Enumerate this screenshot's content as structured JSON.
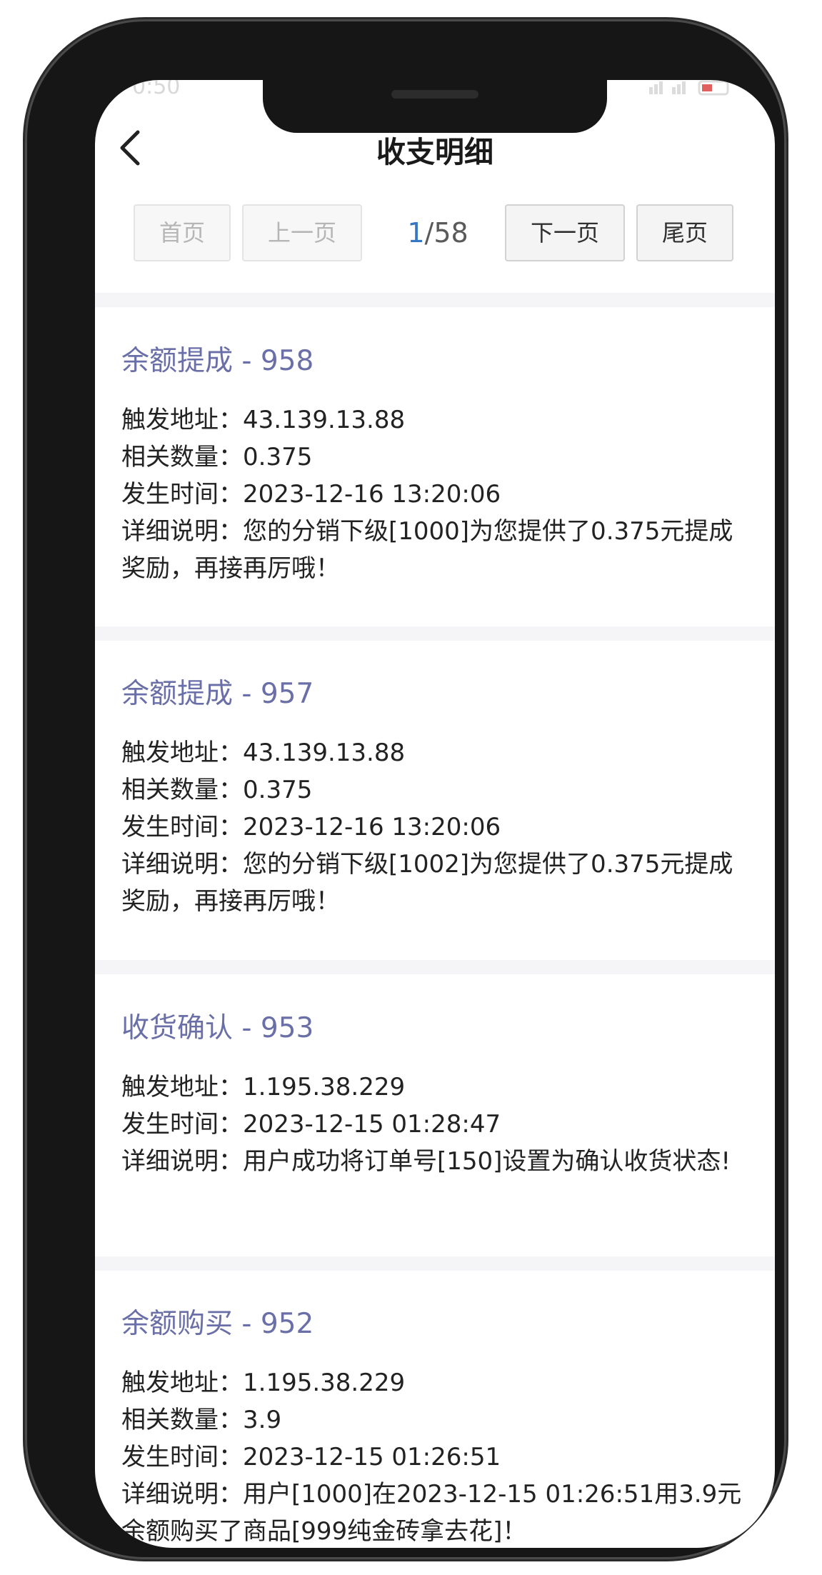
{
  "status_bar": {
    "time": "0:50",
    "icons": "signal-icon wifi-icon battery-icon"
  },
  "header": {
    "title": "收支明细"
  },
  "pager": {
    "first": "首页",
    "prev": "上一页",
    "current": "1",
    "separator": "/",
    "total": "58",
    "next": "下一页",
    "last": "尾页"
  },
  "labels": {
    "address": "触发地址：",
    "amount": "相关数量：",
    "time": "发生时间：",
    "detail": "详细说明："
  },
  "records": [
    {
      "title": "余额提成 - 958",
      "address": "43.139.13.88",
      "amount": "0.375",
      "time": "2023-12-16 13:20:06",
      "detail": "您的分销下级[1000]为您提供了0.375元提成奖励，再接再厉哦！"
    },
    {
      "title": "余额提成 - 957",
      "address": "43.139.13.88",
      "amount": "0.375",
      "time": "2023-12-16 13:20:06",
      "detail": "您的分销下级[1002]为您提供了0.375元提成奖励，再接再厉哦！"
    },
    {
      "title": "收货确认 - 953",
      "address": "1.195.38.229",
      "time": "2023-12-15 01:28:47",
      "detail": "用户成功将订单号[150]设置为确认收货状态!"
    },
    {
      "title": "余额购买 - 952",
      "address": "1.195.38.229",
      "amount": "3.9",
      "time": "2023-12-15 01:26:51",
      "detail": "用户[1000]在2023-12-15 01:26:51用3.9元余额购买了商品[999纯金砖拿去花]！"
    }
  ],
  "colors": {
    "record_title": "#6a6fa8",
    "pager_current": "#3577c4"
  }
}
